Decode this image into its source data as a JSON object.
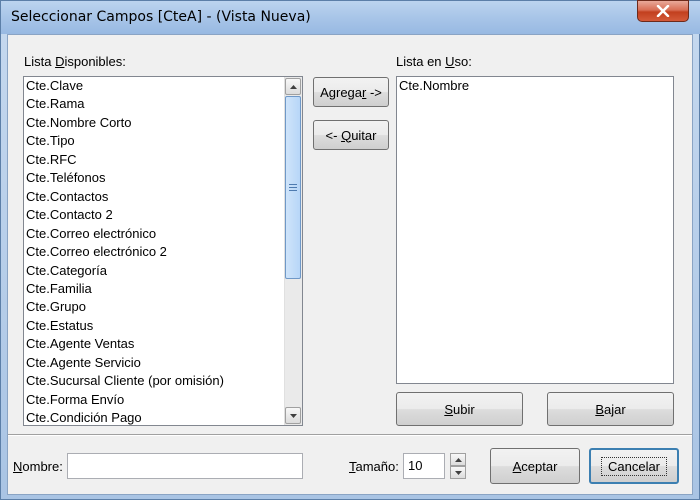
{
  "window": {
    "title": "Seleccionar Campos [CteA] - (Vista Nueva)"
  },
  "available": {
    "label": "Lista Disponibles:",
    "items": [
      "Cte.Clave",
      "Cte.Rama",
      "Cte.Nombre Corto",
      "Cte.Tipo",
      "Cte.RFC",
      "Cte.Teléfonos",
      "Cte.Contactos",
      "Cte.Contacto 2",
      "Cte.Correo electrónico",
      "Cte.Correo electrónico 2",
      "Cte.Categoría",
      "Cte.Familia",
      "Cte.Grupo",
      "Cte.Estatus",
      "Cte.Agente Ventas",
      "Cte.Agente Servicio",
      "Cte.Sucursal Cliente (por omisión)",
      "Cte.Forma Envío",
      "Cte.Condición Pago"
    ]
  },
  "in_use": {
    "label": "Lista en Uso:",
    "items": [
      "Cte.Nombre"
    ]
  },
  "buttons": {
    "add": "Agregar ->",
    "remove": "<- Quitar",
    "up": "Subir",
    "down": "Bajar",
    "ok": "Aceptar",
    "cancel": "Cancelar"
  },
  "footer": {
    "name_label": "Nombre:",
    "name_value": "",
    "size_label": "Tamaño:",
    "size_value": "10"
  },
  "colors": {
    "close_button": "#c2401f",
    "scroll_thumb": "#b7d6f7"
  },
  "icons": {
    "close": "close-icon",
    "scroll_up": "arrow-up-icon",
    "scroll_down": "arrow-down-icon",
    "spin_up": "spin-up-icon",
    "spin_down": "spin-down-icon"
  }
}
